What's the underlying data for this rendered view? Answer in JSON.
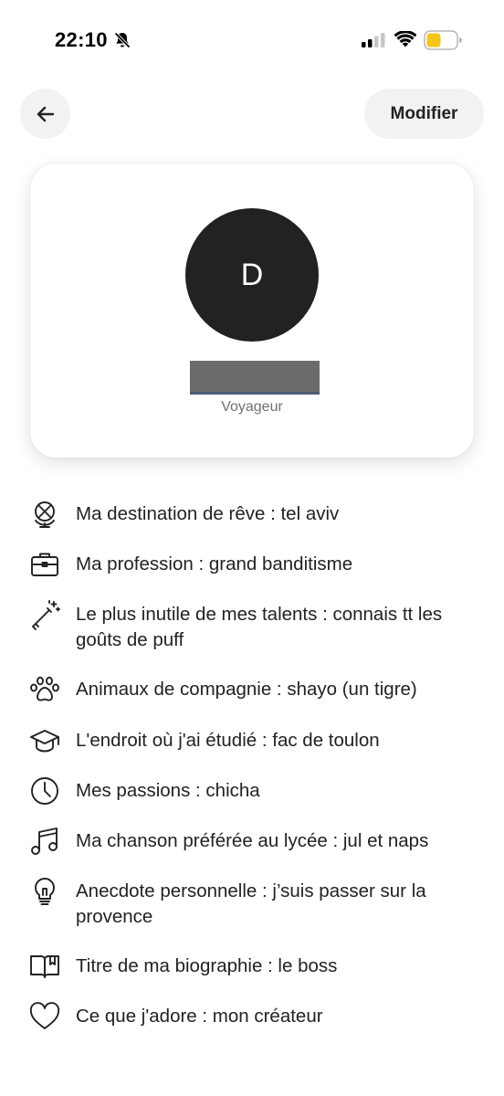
{
  "status_bar": {
    "time": "22:10",
    "battery_color": "#f5c518"
  },
  "header": {
    "back_icon": "arrow-left-icon",
    "edit_label": "Modifier"
  },
  "profile": {
    "avatar_initial": "D",
    "role": "Voyageur"
  },
  "facts": [
    {
      "icon": "globe-crossed-icon",
      "text": "Ma destination de rêve : tel aviv"
    },
    {
      "icon": "briefcase-icon",
      "text": "Ma profession : grand banditisme"
    },
    {
      "icon": "magic-wand-icon",
      "text": "Le plus inutile de mes talents : connais tt les goûts de puff"
    },
    {
      "icon": "paw-icon",
      "text": "Animaux de compagnie : shayo (un tigre)"
    },
    {
      "icon": "graduation-cap-icon",
      "text": "L'endroit où j'ai étudié : fac de toulon"
    },
    {
      "icon": "clock-icon",
      "text": "Mes passions : chicha"
    },
    {
      "icon": "music-note-icon",
      "text": "Ma chanson préférée au lycée : jul et naps"
    },
    {
      "icon": "lightbulb-icon",
      "text": "Anecdote personnelle : j’suis passer sur la provence"
    },
    {
      "icon": "book-icon",
      "text": "Titre de ma biographie : le boss"
    },
    {
      "icon": "heart-icon",
      "text": "Ce que j'adore : mon créateur"
    }
  ]
}
